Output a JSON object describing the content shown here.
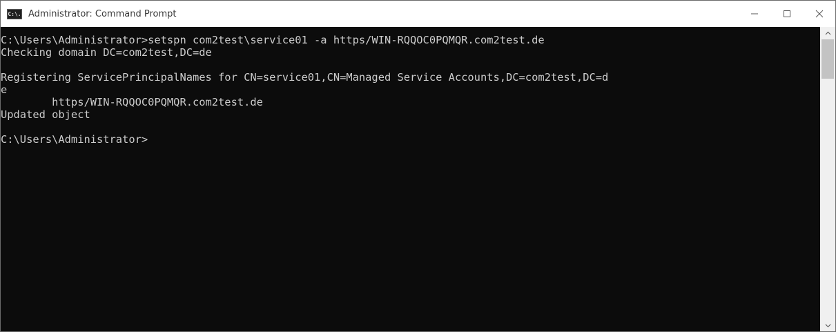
{
  "window": {
    "title": "Administrator: Command Prompt",
    "app_icon_text": "C:\\."
  },
  "terminal": {
    "lines": [
      "C:\\Users\\Administrator>setspn com2test\\service01 -a https/WIN-RQQOC0PQMQR.com2test.de",
      "Checking domain DC=com2test,DC=de",
      "",
      "Registering ServicePrincipalNames for CN=service01,CN=Managed Service Accounts,DC=com2test,DC=d",
      "e",
      "        https/WIN-RQQOC0PQMQR.com2test.de",
      "Updated object",
      "",
      "C:\\Users\\Administrator>"
    ]
  },
  "colors": {
    "background": "#0c0c0c",
    "text": "#cccccc"
  }
}
